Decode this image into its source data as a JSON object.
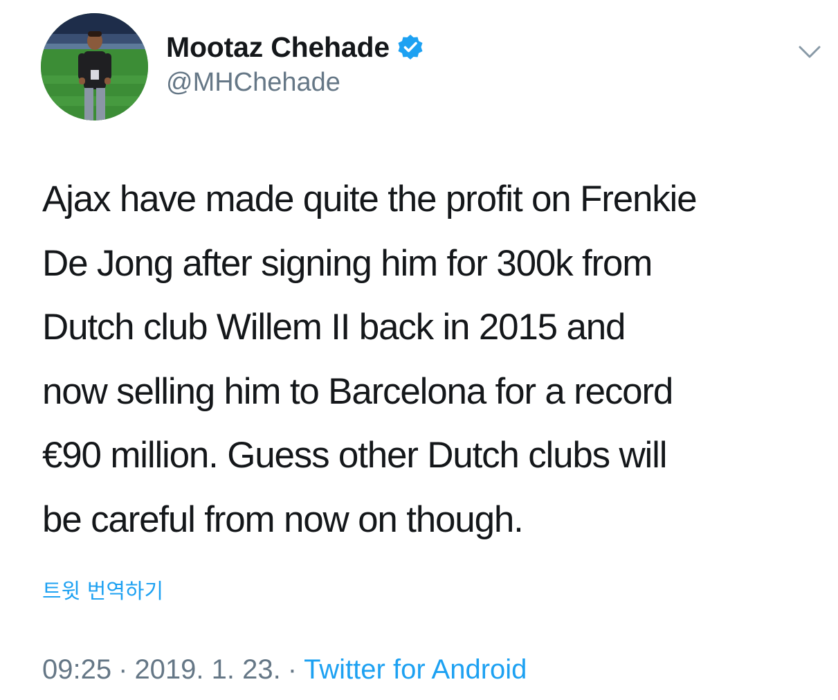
{
  "tweet": {
    "author": {
      "display_name": "Mootaz Chehade",
      "handle": "@MHChehade",
      "verified": true
    },
    "text_lines": [
      "Ajax have made quite the profit on Frenkie",
      "De Jong after signing him for 300k from",
      "Dutch club Willem II back in 2015 and",
      "now selling him to Barcelona for a record",
      "€90 million. Guess other Dutch clubs will",
      "be careful from now on though."
    ],
    "translate_label": "트윗 번역하기",
    "time": "09:25",
    "separator": "·",
    "date": "2019. 1. 23.",
    "source": "Twitter for Android"
  },
  "icons": {
    "verified": "verified-badge-icon",
    "menu": "chevron-down-icon"
  },
  "colors": {
    "accent": "#1da1f2",
    "text": "#14171a",
    "muted": "#657786",
    "background": "#ffffff"
  }
}
